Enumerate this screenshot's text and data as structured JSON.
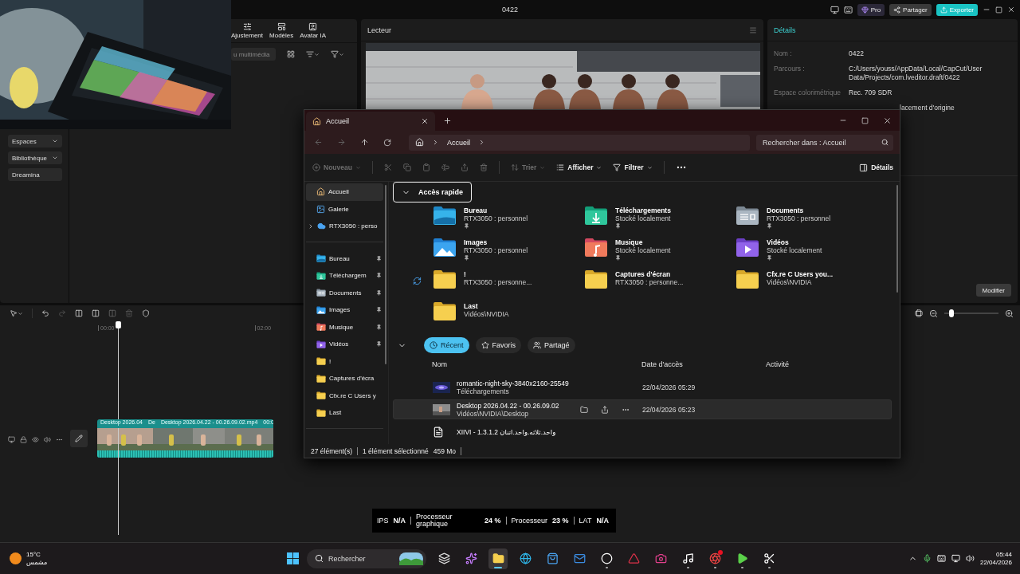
{
  "capcut": {
    "title": "0422",
    "header_buttons": [
      {
        "kind": "pro",
        "label": "Pro"
      },
      {
        "kind": "share",
        "label": "Partager"
      },
      {
        "kind": "export",
        "label": "Exporter"
      }
    ],
    "tools": [
      {
        "kind": "adjust",
        "label": "Ajustement"
      },
      {
        "kind": "templates",
        "label": "Modèles"
      },
      {
        "kind": "avatar",
        "label": "Avatar IA"
      }
    ],
    "media_search": {
      "placeholder": "u multimédia"
    },
    "sidebar": [
      {
        "label": "Espaces",
        "dropdown": true
      },
      {
        "label": "Bibliothèque",
        "dropdown": true
      },
      {
        "label": "Dreamina",
        "dropdown": false
      }
    ],
    "player": {
      "title": "Lecteur",
      "kind": "picture"
    },
    "details": {
      "title": "Détails",
      "fields": [
        {
          "label": "Nom :",
          "value": "0422"
        },
        {
          "label": "Parcours :",
          "value": "C:/Users/youss/AppData/Local/CapCut/User Data/Projects/com.lveditor.draft/0422"
        },
        {
          "label": "Espace colorimétrique",
          "value": "Rec. 709 SDR"
        },
        {
          "value": "lacement d'origine"
        }
      ],
      "button": "Modifier"
    },
    "timeline": {
      "ticks": [
        "00:00",
        "02:00"
      ],
      "clips": [
        {
          "label": "Desktop 2026.04"
        },
        {
          "label": "De"
        },
        {
          "label": "Desktop 2026.04.22 - 00.26.09.02.mp4"
        },
        {
          "label": "00:0"
        }
      ],
      "zoom": {
        "level": 0.13
      }
    }
  },
  "explorer": {
    "tab": "Accueil",
    "address": "Accueil",
    "search": {
      "placeholder": "Rechercher dans : Accueil"
    },
    "toolbar": [
      {
        "kind": "new",
        "label": "Nouveau",
        "disabled": true
      },
      {
        "kind": "cut",
        "disabled": true
      },
      {
        "kind": "copy",
        "disabled": true
      },
      {
        "kind": "paste",
        "disabled": true
      },
      {
        "kind": "rename",
        "disabled": true
      },
      {
        "kind": "share",
        "disabled": true
      },
      {
        "kind": "delete",
        "disabled": true
      },
      {
        "kind": "sort",
        "label": "Trier",
        "disabled": true
      },
      {
        "kind": "view",
        "label": "Afficher",
        "disabled": false
      },
      {
        "kind": "filter",
        "label": "Filtrer",
        "disabled": false
      },
      {
        "kind": "more",
        "disabled": false
      }
    ],
    "details_button": "Détails",
    "sidebar": [
      {
        "items": [
          {
            "label": "Accueil",
            "kind": "home",
            "selected": true,
            "pinned": false,
            "expandable": false
          },
          {
            "label": "Galerie",
            "kind": "gallery",
            "selected": false,
            "pinned": false,
            "expandable": false
          },
          {
            "label": "RTX3050 : perso",
            "kind": "cloud",
            "selected": false,
            "pinned": false,
            "expandable": true
          }
        ]
      },
      {
        "items": [
          {
            "label": "Bureau",
            "kind": "desktop",
            "selected": false,
            "pinned": true,
            "expandable": false
          },
          {
            "label": "Téléchargem",
            "kind": "download",
            "selected": false,
            "pinned": true,
            "expandable": false
          },
          {
            "label": "Documents",
            "kind": "documents",
            "selected": false,
            "pinned": true,
            "expandable": false
          },
          {
            "label": "Images",
            "kind": "images",
            "selected": false,
            "pinned": true,
            "expandable": false
          },
          {
            "label": "Musique",
            "kind": "music",
            "selected": false,
            "pinned": true,
            "expandable": false
          },
          {
            "label": "Vidéos",
            "kind": "videos",
            "selected": false,
            "pinned": true,
            "expandable": false
          },
          {
            "label": "!",
            "kind": "folder",
            "selected": false,
            "pinned": false,
            "expandable": false
          },
          {
            "label": "Captures d'écra",
            "kind": "folder",
            "selected": false,
            "pinned": false,
            "expandable": false
          },
          {
            "label": "Cfx.re  C  Users y",
            "kind": "folder",
            "selected": false,
            "pinned": false,
            "expandable": false
          },
          {
            "label": "Last",
            "kind": "folder",
            "selected": false,
            "pinned": false,
            "expandable": false
          }
        ]
      }
    ],
    "quick_access": {
      "title": "Accès rapide",
      "expanded": true,
      "items": [
        {
          "name": "Bureau",
          "location": "RTX3050 : personnel",
          "kind": "desktop",
          "pinned": true,
          "syncing": false
        },
        {
          "name": "Téléchargements",
          "location": "Stocké localement",
          "kind": "download",
          "pinned": true,
          "syncing": false
        },
        {
          "name": "Documents",
          "location": "RTX3050 : personnel",
          "kind": "documents",
          "pinned": true,
          "syncing": false
        },
        {
          "name": "Images",
          "location": "RTX3050 : personnel",
          "kind": "images",
          "pinned": true,
          "syncing": false
        },
        {
          "name": "Musique",
          "location": "Stocké localement",
          "kind": "music",
          "pinned": true,
          "syncing": false
        },
        {
          "name": "Vidéos",
          "location": "Stocké localement",
          "kind": "videos",
          "pinned": true,
          "syncing": false
        },
        {
          "name": "!",
          "location": "RTX3050 : personne...",
          "kind": "folder",
          "pinned": false,
          "syncing": true
        },
        {
          "name": "Captures d'écran",
          "location": "RTX3050 : personne...",
          "kind": "folder",
          "pinned": false,
          "syncing": false
        },
        {
          "name": "Cfx.re  C  Users you...",
          "location": "Vidéos\\NVIDIA",
          "kind": "folder",
          "pinned": false,
          "syncing": false
        },
        {
          "name": "Last",
          "location": "Vidéos\\NVIDIA",
          "kind": "folder",
          "pinned": false,
          "syncing": false
        }
      ]
    },
    "recent": {
      "expanded": true,
      "tabs": [
        {
          "kind": "recent",
          "label": "Récent",
          "selected": true
        },
        {
          "kind": "favorites",
          "label": "Favoris",
          "selected": false
        },
        {
          "kind": "shared",
          "label": "Partagé",
          "selected": false
        }
      ],
      "columns": [
        "Nom",
        "Date d'accès",
        "Activité"
      ],
      "rows": [
        {
          "kind": "sky",
          "name": "romantic-night-sky-3840x2160-25549",
          "location": "Téléchargements",
          "date": "22/04/2026 05:29",
          "selected": false
        },
        {
          "kind": "video",
          "name": "Desktop 2026.04.22 - 00.26.09.02",
          "location": "Vidéos\\NVIDIA\\Desktop",
          "date": "22/04/2026 05:23",
          "selected": true
        },
        {
          "kind": "file",
          "name": "XIIVI - 1.3.1.2 واحد.ثلاثه.واحد.اتنان",
          "selected": false
        }
      ]
    },
    "status": [
      "27 élément(s)",
      "1 élément sélectionné",
      "459 Mo"
    ]
  },
  "performance_overlay": [
    {
      "label": "IPS",
      "value": "N/A"
    },
    {
      "label": "Processeur graphique",
      "value": "24 %"
    },
    {
      "label": "Processeur",
      "value": "23 %"
    },
    {
      "label": "LAT",
      "value": "N/A"
    }
  ],
  "taskbar": {
    "weather": {
      "temperature": "15°C",
      "condition": "مشمس"
    },
    "search": {
      "placeholder": "Rechercher"
    },
    "apps": [
      {
        "kind": "taskview",
        "running": false,
        "active": false,
        "badge": false
      },
      {
        "kind": "copilot",
        "running": false,
        "active": false,
        "badge": false
      },
      {
        "kind": "explorer",
        "running": true,
        "active": true,
        "badge": false
      },
      {
        "kind": "edge",
        "running": false,
        "active": false,
        "badge": false
      },
      {
        "kind": "store",
        "running": false,
        "active": false,
        "badge": false
      },
      {
        "kind": "mail",
        "running": false,
        "active": false,
        "badge": false
      },
      {
        "kind": "ring",
        "running": true,
        "active": false,
        "badge": false
      },
      {
        "kind": "triangle",
        "running": false,
        "active": false,
        "badge": false
      },
      {
        "kind": "camera",
        "running": false,
        "active": false,
        "badge": false
      },
      {
        "kind": "note",
        "running": true,
        "active": false,
        "badge": false
      },
      {
        "kind": "aperture",
        "running": true,
        "active": false,
        "badge": true
      },
      {
        "kind": "play",
        "running": true,
        "active": false,
        "badge": false
      },
      {
        "kind": "scissors",
        "running": true,
        "active": false,
        "badge": false
      }
    ],
    "time": "05:44",
    "date": "22/04/2026"
  }
}
